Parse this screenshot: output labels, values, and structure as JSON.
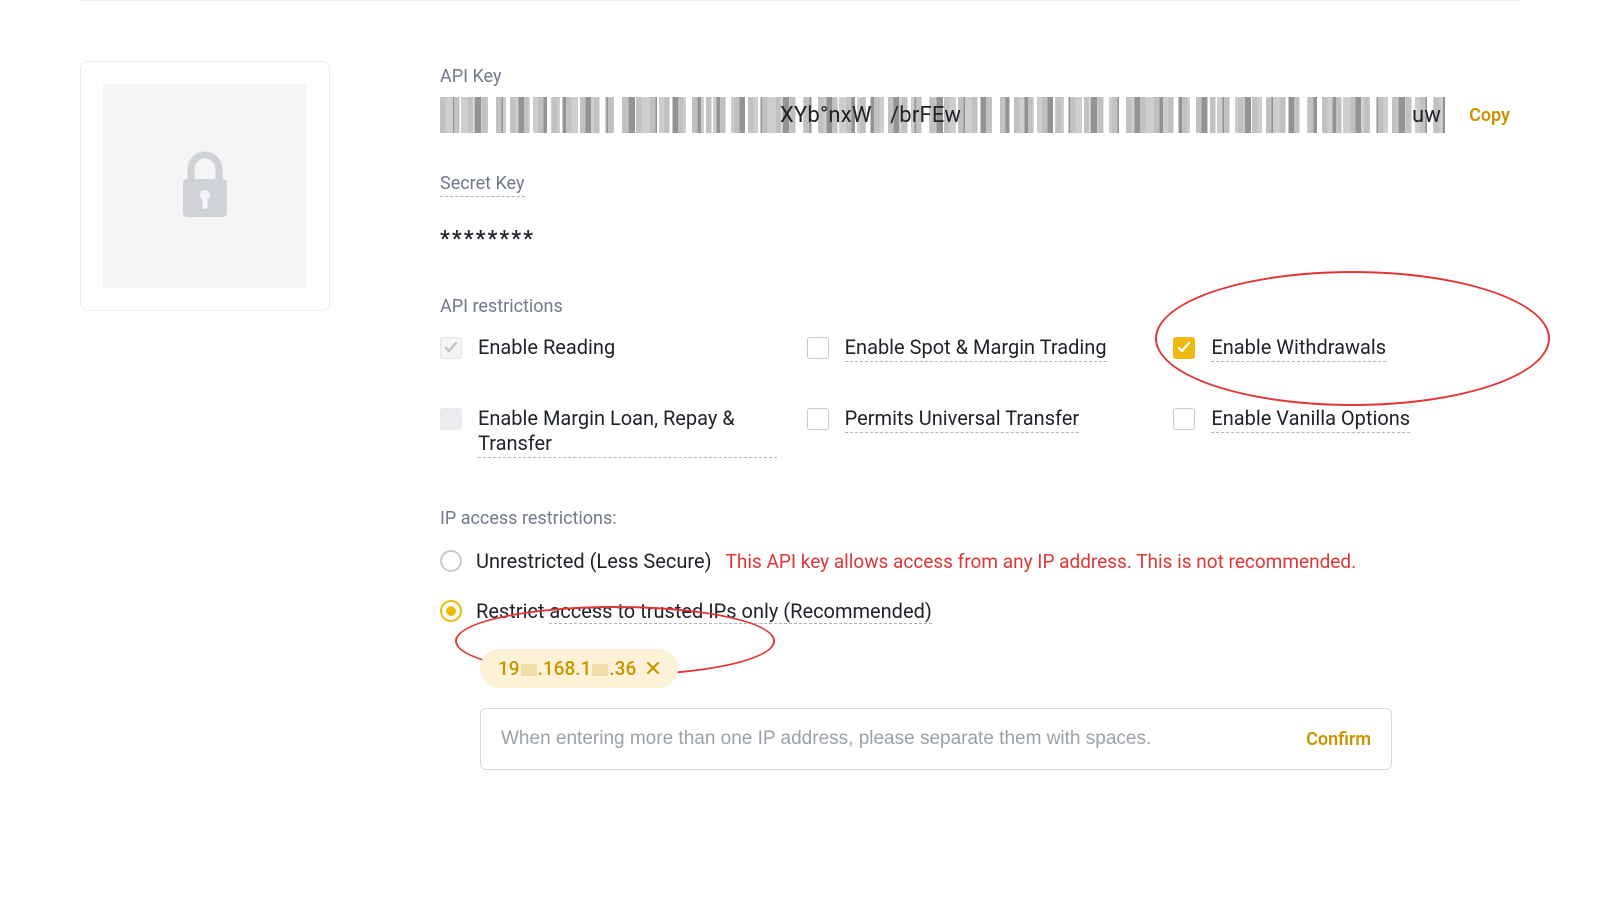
{
  "labels": {
    "api_key": "API Key",
    "secret_key": "Secret Key",
    "api_restrictions": "API restrictions",
    "ip_restrictions": "IP access restrictions:"
  },
  "api_key": {
    "fragment_mid": "XYb°nxW",
    "fragment_mid2": "/brFEw",
    "fragment_end": "uw",
    "copy_label": "Copy"
  },
  "secret_key": {
    "masked": "********"
  },
  "restrictions": {
    "enable_reading": "Enable Reading",
    "enable_spot_margin": "Enable Spot & Margin Trading",
    "enable_withdrawals": "Enable Withdrawals",
    "enable_margin_loan": "Enable Margin Loan, Repay & Transfer",
    "permits_universal": "Permits Universal Transfer",
    "enable_vanilla": "Enable Vanilla Options"
  },
  "ip": {
    "unrestricted_label": "Unrestricted (Less Secure)",
    "unrestricted_warn": "This API key allows access from any IP address. This is not recommended.",
    "restricted_label": "Restrict access to trusted IPs only (Recommended)",
    "chip_prefix": "19",
    "chip_mid": ".168.1",
    "chip_suffix": ".36",
    "input_placeholder": "When entering more than one IP address, please separate them with spaces.",
    "confirm_label": "Confirm"
  }
}
